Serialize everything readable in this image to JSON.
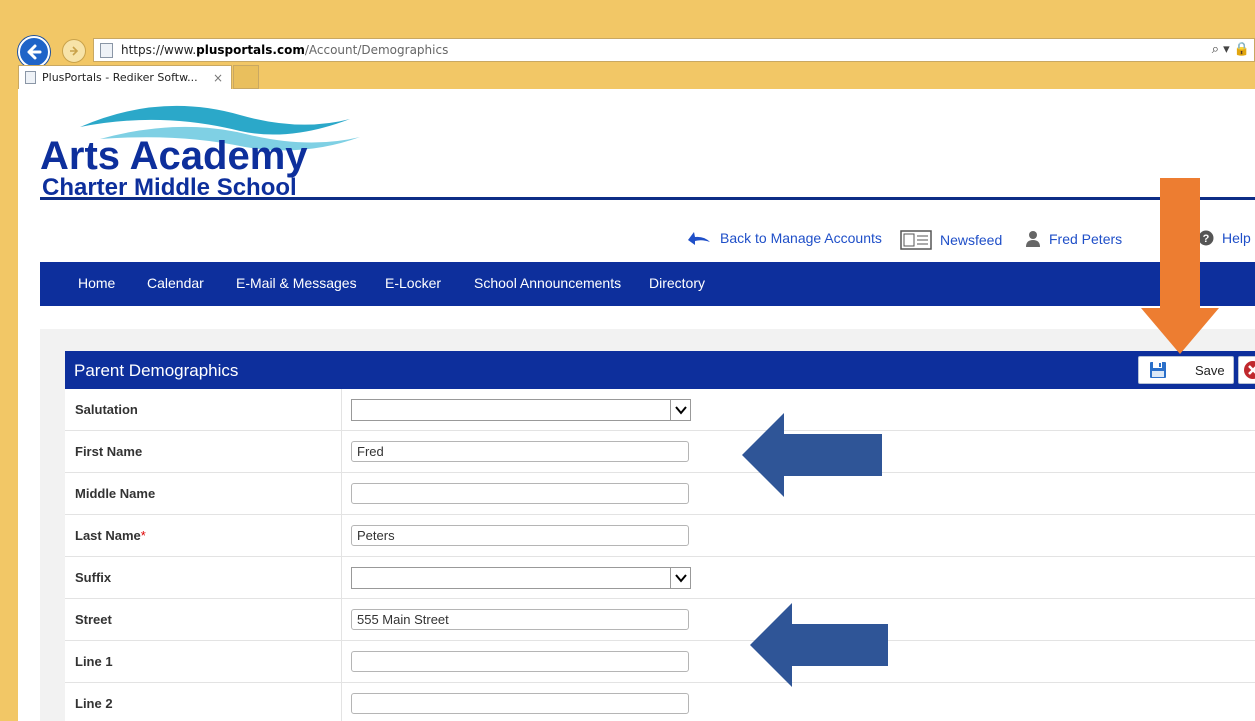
{
  "browser": {
    "url_prefix": "https://www.",
    "url_domain": "plusportals.com",
    "url_path": "/Account/Demographics",
    "tab_title": "PlusPortals - Rediker Softw...",
    "tab_close": "×",
    "addr_icons": "⌕ ▾ 🔒"
  },
  "school": {
    "name_line1": "Arts Academy",
    "name_line2": "Charter Middle School"
  },
  "top_links": {
    "back": "Back to Manage Accounts",
    "newsfeed": "Newsfeed",
    "user": "Fred Peters",
    "help": "Help"
  },
  "nav": [
    "Home",
    "Calendar",
    "E-Mail & Messages",
    "E-Locker",
    "School Announcements",
    "Directory"
  ],
  "panel": {
    "title": "Parent Demographics",
    "save_label": "Save"
  },
  "form": [
    {
      "label": "Salutation",
      "type": "select",
      "value": "",
      "required": false
    },
    {
      "label": "First Name",
      "type": "text",
      "value": "Fred",
      "required": false
    },
    {
      "label": "Middle Name",
      "type": "text",
      "value": "",
      "required": false
    },
    {
      "label": "Last Name",
      "type": "text",
      "value": "Peters",
      "required": true
    },
    {
      "label": "Suffix",
      "type": "select",
      "value": "",
      "required": false
    },
    {
      "label": "Street",
      "type": "text",
      "value": "555 Main Street",
      "required": false
    },
    {
      "label": "Line 1",
      "type": "text",
      "value": "",
      "required": false
    },
    {
      "label": "Line 2",
      "type": "text",
      "value": "",
      "required": false
    }
  ],
  "required_marker": "*",
  "colors": {
    "brand_blue": "#0d2f9c",
    "link_blue": "#1f4fc8",
    "annotation_orange": "#ed7d31",
    "annotation_blue": "#2f5597"
  }
}
